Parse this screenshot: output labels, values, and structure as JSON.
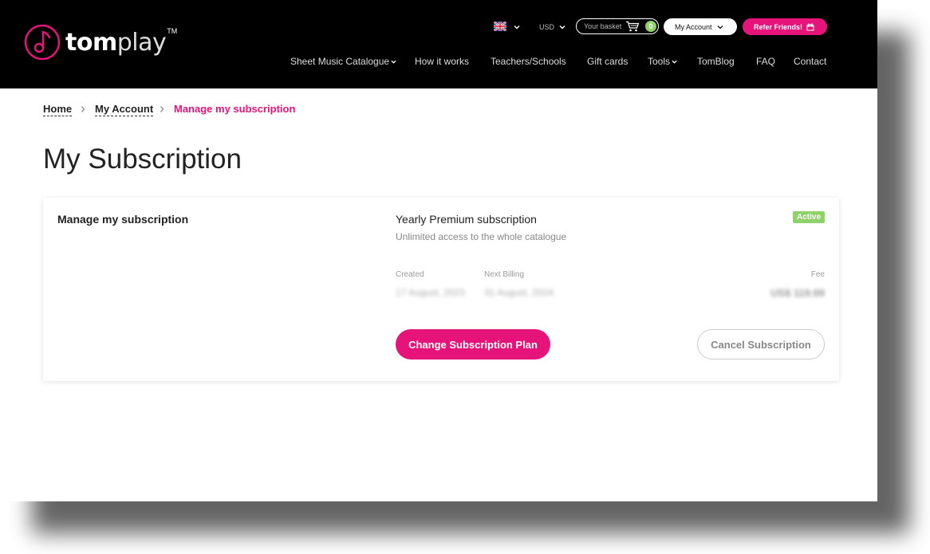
{
  "header": {
    "logo": {
      "brand_bold": "tom",
      "brand_light": "play",
      "trademark": "TM"
    },
    "language_icon": "uk-flag-icon",
    "currency": "USD",
    "basket": {
      "label": "Your basket",
      "count": "0"
    },
    "account_label": "My Account",
    "refer_label": "Refer Friends!",
    "nav": [
      {
        "label": "Sheet Music Catalogue",
        "dropdown": true
      },
      {
        "label": "How it works",
        "dropdown": false
      },
      {
        "label": "Teachers/Schools",
        "dropdown": false
      },
      {
        "label": "Gift cards",
        "dropdown": false
      },
      {
        "label": "Tools",
        "dropdown": true
      },
      {
        "label": "TomBlog",
        "dropdown": false
      },
      {
        "label": "FAQ",
        "dropdown": false
      },
      {
        "label": "Contact",
        "dropdown": false
      }
    ]
  },
  "breadcrumb": {
    "home": "Home",
    "account": "My Account",
    "current": "Manage my subscription"
  },
  "page_title": "My Subscription",
  "card": {
    "heading": "Manage my subscription",
    "plan_name": "Yearly Premium subscription",
    "plan_desc": "Unlimited access to the whole catalogue",
    "status": "Active",
    "created_label": "Created",
    "created_value": "17 August, 2023",
    "next_billing_label": "Next Billing",
    "next_billing_value": "31 August, 2024",
    "fee_label": "Fee",
    "fee_value": "US$ 119.99",
    "change_label": "Change Subscription Plan",
    "cancel_label": "Cancel Subscription"
  },
  "colors": {
    "brand_pink": "#e6147a",
    "active_green": "#8fd16a",
    "header_bg": "#000000"
  }
}
